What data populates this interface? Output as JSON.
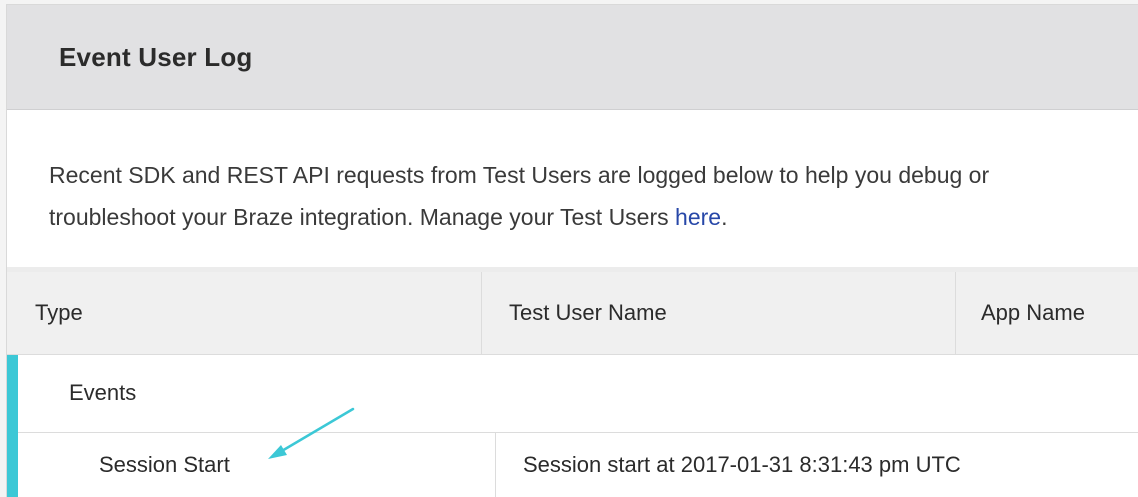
{
  "panel": {
    "title": "Event User Log"
  },
  "description": {
    "text_before_link": "Recent SDK and REST API requests from Test Users are logged below to help you debug or troubleshoot your Braze integration. Manage your Test Users ",
    "link_text": "here",
    "text_after_link": "."
  },
  "table": {
    "columns": [
      "Type",
      "Test User Name",
      "App Name"
    ],
    "group": {
      "label": "Events"
    },
    "rows": [
      {
        "name": "Session Start",
        "detail": "Session start at 2017-01-31 8:31:43 pm UTC"
      }
    ]
  },
  "colors": {
    "header_bg": "#e1e1e3",
    "accent": "#3cc8d6",
    "link": "#2747a8",
    "annotation_arrow": "#3cc8d6"
  },
  "annotation": {
    "icon": "arrow-icon",
    "points_to": "Session Start"
  }
}
